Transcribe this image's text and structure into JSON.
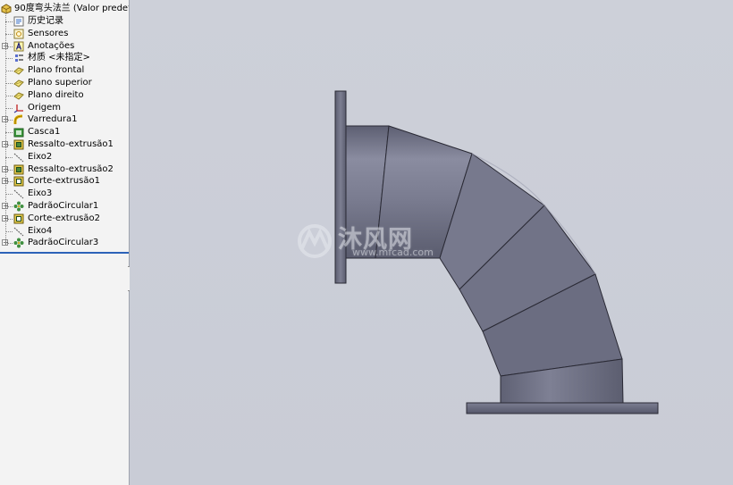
{
  "feature_tree": {
    "root_label": "90度弯头法兰 (Valor predete",
    "items": [
      {
        "label": "历史记录",
        "icon": "history-icon",
        "expandable": false
      },
      {
        "label": "Sensores",
        "icon": "sensors-icon",
        "expandable": false
      },
      {
        "label": "Anotações",
        "icon": "annotations-icon",
        "expandable": true
      },
      {
        "label": "材质 <未指定>",
        "icon": "material-icon",
        "expandable": false
      },
      {
        "label": "Plano frontal",
        "icon": "plane-icon",
        "expandable": false
      },
      {
        "label": "Plano superior",
        "icon": "plane-icon",
        "expandable": false
      },
      {
        "label": "Plano direito",
        "icon": "plane-icon",
        "expandable": false
      },
      {
        "label": "Origem",
        "icon": "origin-icon",
        "expandable": false
      },
      {
        "label": "Varredura1",
        "icon": "sweep-icon",
        "expandable": true
      },
      {
        "label": "Casca1",
        "icon": "shell-icon",
        "expandable": false
      },
      {
        "label": "Ressalto-extrusão1",
        "icon": "extrude-boss-icon",
        "expandable": true
      },
      {
        "label": "Eixo2",
        "icon": "axis-icon",
        "expandable": false
      },
      {
        "label": "Ressalto-extrusão2",
        "icon": "extrude-boss-icon",
        "expandable": true
      },
      {
        "label": "Corte-extrusão1",
        "icon": "extrude-cut-icon",
        "expandable": true
      },
      {
        "label": "Eixo3",
        "icon": "axis-icon",
        "expandable": false
      },
      {
        "label": "PadrãoCircular1",
        "icon": "circular-pattern-icon",
        "expandable": true
      },
      {
        "label": "Corte-extrusão2",
        "icon": "extrude-cut-icon",
        "expandable": true
      },
      {
        "label": "Eixo4",
        "icon": "axis-icon",
        "expandable": false
      },
      {
        "label": "PadrãoCircular3",
        "icon": "circular-pattern-icon",
        "expandable": true
      }
    ]
  },
  "watermark": {
    "text": "沐风网",
    "url": "www.mfcad.com"
  },
  "colors": {
    "viewport_bg": "#c9ccd6",
    "model_gray": "#6e7084",
    "rollback_bar": "#2c62b8"
  }
}
